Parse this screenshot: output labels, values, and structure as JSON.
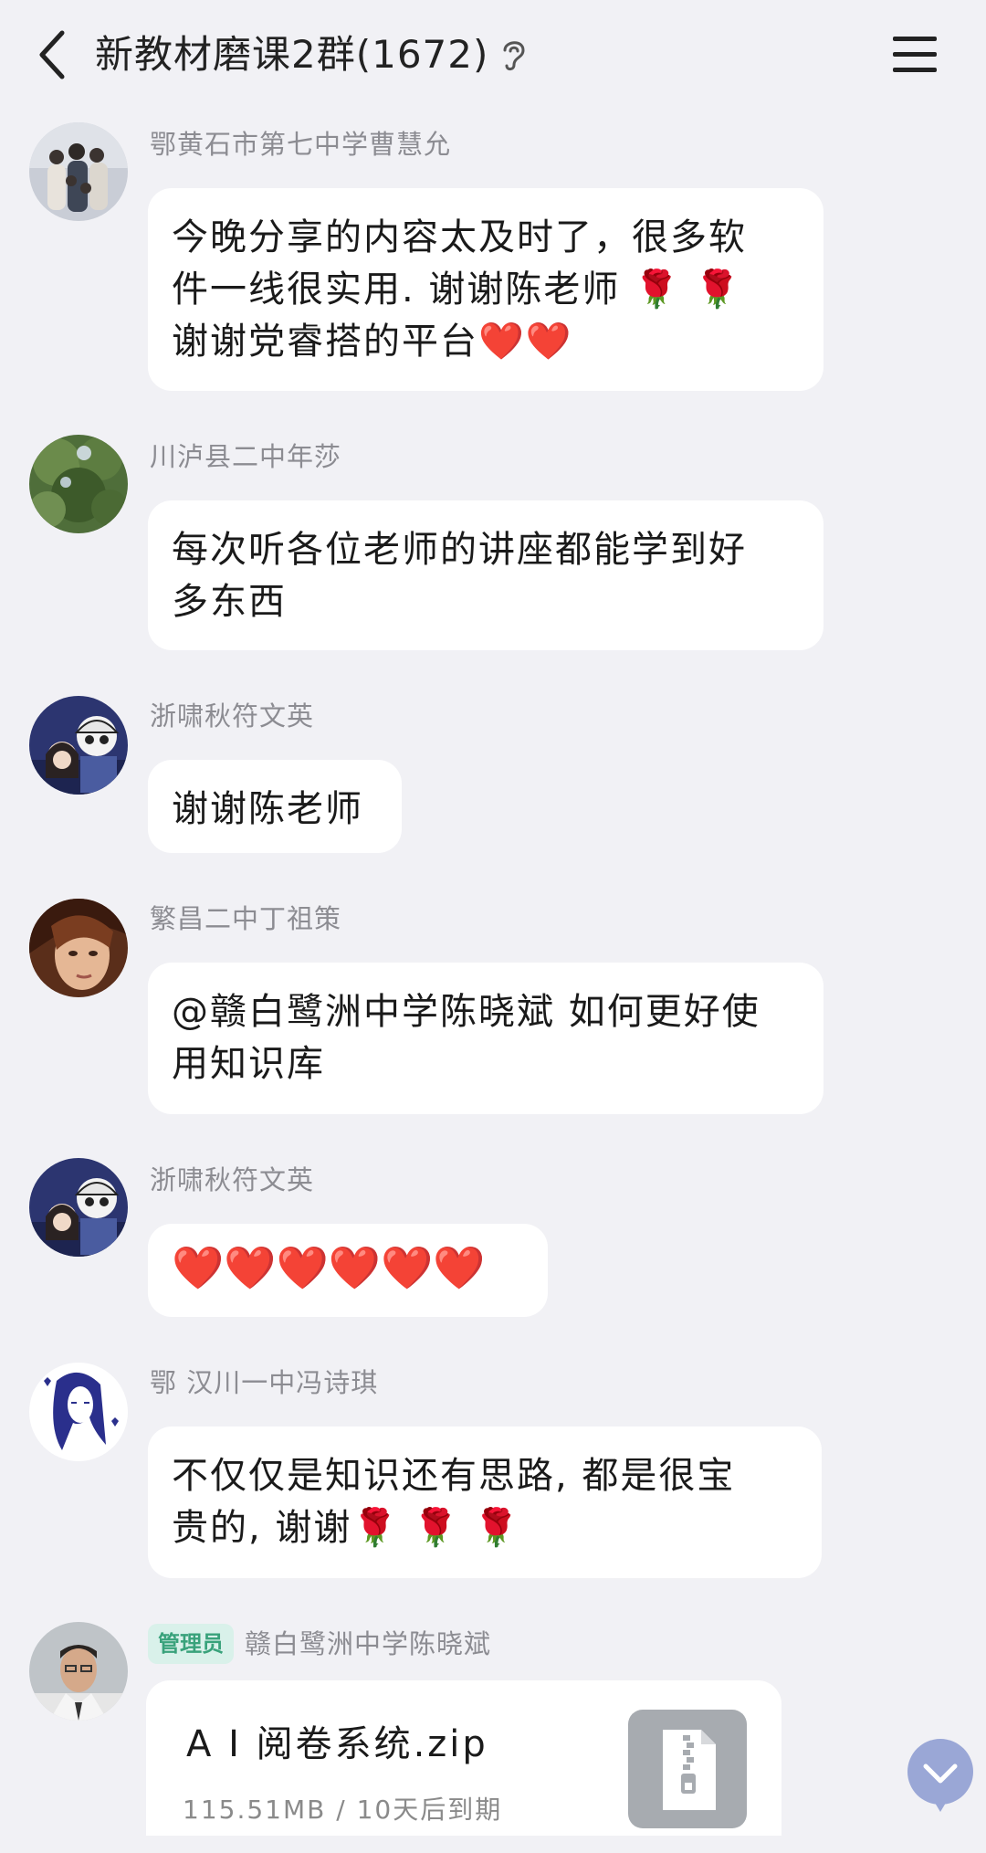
{
  "header": {
    "title": "新教材磨课2群(1672)",
    "back_icon": "chevron-left-icon",
    "ear_icon": "ear-icon",
    "menu_icon": "hamburger-menu-icon"
  },
  "messages": [
    {
      "sender": "鄂黄石市第七中学曹慧允",
      "line1": "今晚分享的内容太及时了，很多软",
      "line2_text": "件一线很实用. 谢谢陈老师",
      "line2_emoji": "🌹 🌹",
      "line3_text": "谢谢党睿搭的平台",
      "line3_emoji": "❤️❤️"
    },
    {
      "sender": "川泸县二中年莎",
      "line1": "每次听各位老师的讲座都能学到好",
      "line2": "多东西"
    },
    {
      "sender": "浙啸秋符文英",
      "text": "谢谢陈老师"
    },
    {
      "sender": "繁昌二中丁祖策",
      "line1": "@赣白鹭洲中学陈晓斌 如何更好使",
      "line2": "用知识库"
    },
    {
      "sender": "浙啸秋符文英",
      "emoji": "❤️❤️❤️❤️❤️❤️"
    },
    {
      "sender": "鄂 汉川一中冯诗琪",
      "line1": "不仅仅是知识还有思路, 都是很宝",
      "line2_text": "贵的, 谢谢",
      "line2_emoji": "🌹 🌹 🌹"
    },
    {
      "admin_badge": "管理员",
      "sender": "赣白鹭洲中学陈晓斌",
      "file": {
        "name": "A I 阅卷系统.zip",
        "meta": "115.51MB / 10天后到期",
        "icon": "zip-file-icon"
      }
    }
  ],
  "scroll_down_icon": "chevron-down-icon",
  "colors": {
    "background": "#f1f1f5",
    "bubble": "#ffffff",
    "admin_badge_bg": "#d9f1ea",
    "admin_badge_text": "#39a27b",
    "scroll_btn": "#9aa7d6"
  }
}
